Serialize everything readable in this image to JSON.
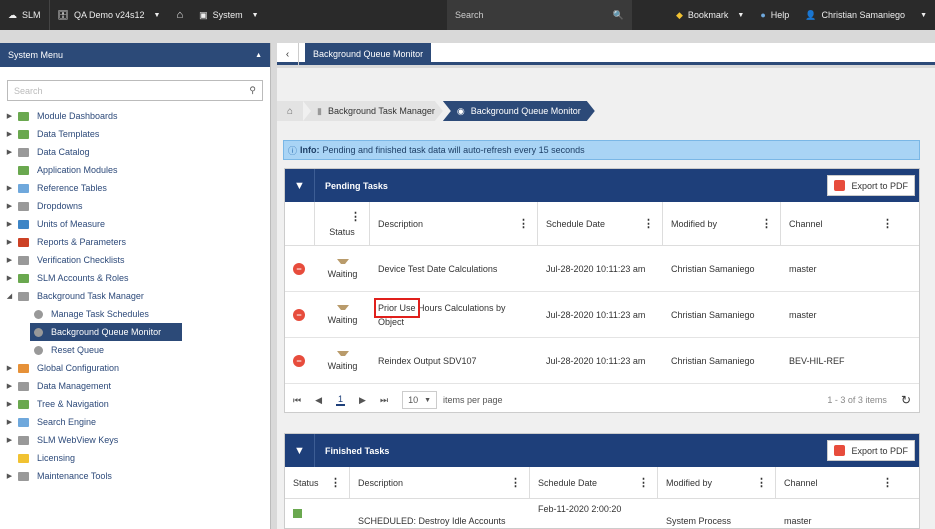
{
  "topbar": {
    "app": "SLM",
    "db": "QA Demo v24s12",
    "system": "System",
    "search_placeholder": "Search",
    "bookmark": "Bookmark",
    "help": "Help",
    "user": "Christian Samaniego"
  },
  "sidebar": {
    "title": "System Menu",
    "search_placeholder": "Search",
    "items": [
      {
        "label": "Module Dashboards",
        "arrow": "▶",
        "color": "#6aa84f",
        "indent": 0
      },
      {
        "label": "Data Templates",
        "arrow": "▶",
        "color": "#6aa84f",
        "indent": 0
      },
      {
        "label": "Data Catalog",
        "arrow": "▶",
        "color": "#999999",
        "indent": 0
      },
      {
        "label": "Application Modules",
        "arrow": "",
        "color": "#6aa84f",
        "indent": 0
      },
      {
        "label": "Reference Tables",
        "arrow": "▶",
        "color": "#6fa8dc",
        "indent": 0
      },
      {
        "label": "Dropdowns",
        "arrow": "▶",
        "color": "#999999",
        "indent": 0
      },
      {
        "label": "Units of Measure",
        "arrow": "▶",
        "color": "#3d85c6",
        "indent": 0
      },
      {
        "label": "Reports & Parameters",
        "arrow": "▶",
        "color": "#cc4125",
        "indent": 0
      },
      {
        "label": "Verification Checklists",
        "arrow": "▶",
        "color": "#999999",
        "indent": 0
      },
      {
        "label": "SLM Accounts & Roles",
        "arrow": "▶",
        "color": "#6aa84f",
        "indent": 0
      },
      {
        "label": "Background Task Manager",
        "arrow": "◢",
        "color": "#999999",
        "indent": 0
      },
      {
        "label": "Manage Task Schedules",
        "arrow": "",
        "color": "#999999",
        "indent": 1
      },
      {
        "label": "Background Queue Monitor",
        "arrow": "",
        "color": "#999999",
        "indent": 1,
        "active": true
      },
      {
        "label": "Reset Queue",
        "arrow": "",
        "color": "#999999",
        "indent": 1
      },
      {
        "label": "Global Configuration",
        "arrow": "▶",
        "color": "#e69138",
        "indent": 0
      },
      {
        "label": "Data Management",
        "arrow": "▶",
        "color": "#999999",
        "indent": 0
      },
      {
        "label": "Tree & Navigation",
        "arrow": "▶",
        "color": "#6aa84f",
        "indent": 0
      },
      {
        "label": "Search Engine",
        "arrow": "▶",
        "color": "#6fa8dc",
        "indent": 0
      },
      {
        "label": "SLM WebView Keys",
        "arrow": "▶",
        "color": "#999999",
        "indent": 0
      },
      {
        "label": "Licensing",
        "arrow": "",
        "color": "#f1c232",
        "indent": 0
      },
      {
        "label": "Maintenance Tools",
        "arrow": "▶",
        "color": "#999999",
        "indent": 0
      }
    ]
  },
  "tab": "Background Queue Monitor",
  "breadcrumb": [
    "Background Task Manager",
    "Background Queue Monitor"
  ],
  "info": {
    "label": "Info:",
    "text": "Pending and finished task data will auto-refresh every 15 seconds"
  },
  "pending": {
    "title": "Pending Tasks",
    "export": "Export to PDF",
    "columns": [
      "Status",
      "Description",
      "Schedule Date",
      "Modified by",
      "Channel"
    ],
    "rows": [
      {
        "status": "Waiting",
        "description": "Device Test Date Calculations",
        "date": "Jul-28-2020 10:11:23 am",
        "modified": "Christian Samaniego",
        "channel": "master"
      },
      {
        "status": "Waiting",
        "description": "Prior Use Hours Calculations by Object",
        "date": "Jul-28-2020 10:11:23 am",
        "modified": "Christian Samaniego",
        "channel": "master"
      },
      {
        "status": "Waiting",
        "description": "Reindex Output SDV107",
        "date": "Jul-28-2020 10:11:23 am",
        "modified": "Christian Samaniego",
        "channel": "BEV-HIL-REF"
      }
    ],
    "pager": {
      "page": "1",
      "per_page": "10",
      "per_page_label": "items per page",
      "summary": "1 - 3 of 3 items"
    }
  },
  "finished": {
    "title": "Finished Tasks",
    "export": "Export to PDF",
    "columns": [
      "Status",
      "Description",
      "Schedule Date",
      "Modified by",
      "Channel"
    ],
    "rows": [
      {
        "description": "SCHEDULED: Destroy Idle Accounts",
        "date": "Feb-11-2020 2:00:20",
        "modified": "System Process",
        "channel": "master"
      }
    ]
  }
}
